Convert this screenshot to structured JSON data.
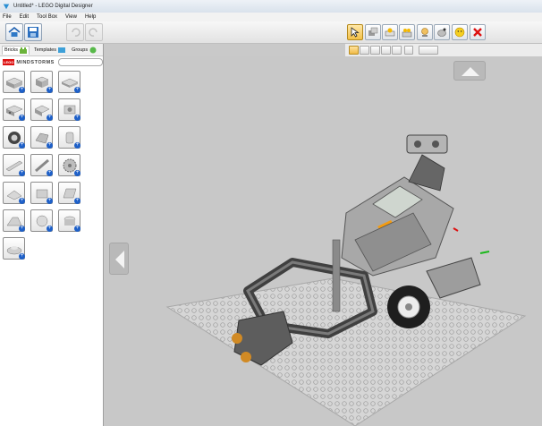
{
  "window": {
    "title": "Untitled* - LEGO Digital Designer"
  },
  "menu": [
    "File",
    "Edit",
    "Tool Box",
    "View",
    "Help"
  ],
  "toolbar": {
    "left_buttons": [
      "home-icon",
      "save-icon",
      "undo-icon",
      "redo-icon"
    ],
    "tools": [
      "select-tool-icon",
      "clone-icon",
      "hinge-icon",
      "hinge-align-icon",
      "flex-icon",
      "paint-icon",
      "minifig-icon",
      "delete-icon"
    ]
  },
  "sidebar": {
    "tabs": [
      {
        "label": "Bricks"
      },
      {
        "label": "Templates"
      },
      {
        "label": "Groups"
      }
    ],
    "brand": "MINDSTORMS"
  },
  "colors": {
    "accent": "#f3c149",
    "plus": "#1e60c8",
    "canvas": "#c8c8c8"
  }
}
